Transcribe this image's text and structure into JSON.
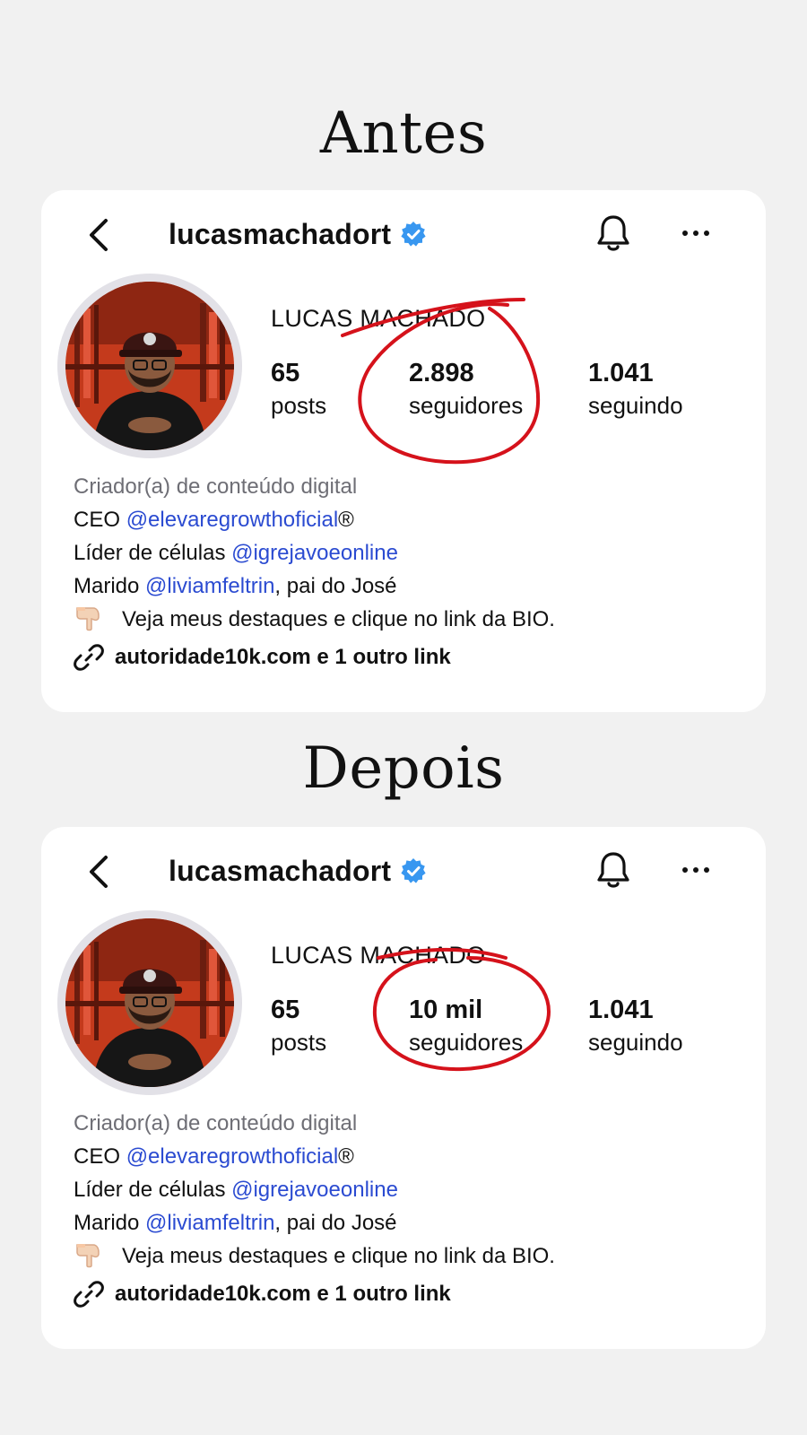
{
  "colors": {
    "background": "#f1f1f1",
    "card": "#ffffff",
    "verified": "#3897f0",
    "mention": "#2b4bd1",
    "category": "#6e6e75",
    "annotation": "#d5121b"
  },
  "before": {
    "title": "Antes",
    "profile": {
      "username": "lucasmachadort",
      "full_name": "LUCAS MACHADO",
      "posts": {
        "value": "65",
        "label": "posts"
      },
      "followers": {
        "value": "2.898",
        "label": "seguidores"
      },
      "following": {
        "value": "1.041",
        "label": "seguindo"
      },
      "bio": {
        "category": "Criador(a) de conteúdo digital",
        "line1_prefix": "CEO ",
        "line1_mention": "@elevaregrowthoficial",
        "line1_suffix": "®",
        "line2_prefix": "Líder de células ",
        "line2_mention": "@igrejavoeonline",
        "line3_prefix": "Marido ",
        "line3_mention": "@liviamfeltrin",
        "line3_suffix": ", pai do José",
        "line4": "Veja meus destaques e clique no link da BIO."
      },
      "link": "autoridade10k.com e 1 outro link"
    }
  },
  "after": {
    "title": "Depois",
    "profile": {
      "username": "lucasmachadort",
      "full_name": "LUCAS MACHADO",
      "posts": {
        "value": "65",
        "label": "posts"
      },
      "followers": {
        "value": "10 mil",
        "label": "seguidores"
      },
      "following": {
        "value": "1.041",
        "label": "seguindo"
      },
      "bio": {
        "category": "Criador(a) de conteúdo digital",
        "line1_prefix": "CEO ",
        "line1_mention": "@elevaregrowthoficial",
        "line1_suffix": "®",
        "line2_prefix": "Líder de células ",
        "line2_mention": "@igrejavoeonline",
        "line3_prefix": "Marido ",
        "line3_mention": "@liviamfeltrin",
        "line3_suffix": ", pai do José",
        "line4": "Veja meus destaques e clique no link da BIO."
      },
      "link": "autoridade10k.com e 1 outro link"
    }
  },
  "icons": {
    "back": "chevron-left-icon",
    "verified": "verified-badge-icon",
    "bell": "bell-icon",
    "more": "more-horizontal-icon",
    "pointing": "hand-pointing-down-icon",
    "link": "link-icon"
  }
}
